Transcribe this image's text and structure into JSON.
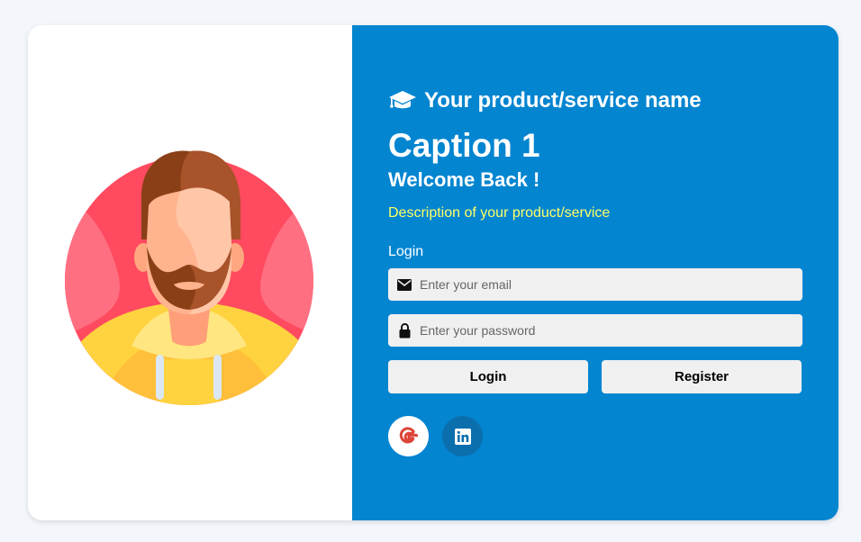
{
  "brand": {
    "icon": "graduation-cap-icon",
    "name": "Your product/service name"
  },
  "caption": "Caption 1",
  "welcome": "Welcome Back !",
  "description": "Description of your product/service",
  "form": {
    "section_label": "Login",
    "email": {
      "icon": "envelope-icon",
      "placeholder": "Enter your email",
      "value": ""
    },
    "password": {
      "icon": "lock-icon",
      "placeholder": "Enter your password",
      "value": ""
    },
    "login_button": "Login",
    "register_button": "Register"
  },
  "social": [
    {
      "name": "google",
      "icon": "google-icon"
    },
    {
      "name": "linkedin",
      "icon": "linkedin-icon"
    }
  ],
  "colors": {
    "page_background": "#f3f6fa",
    "panel_accent": "#0385d0",
    "description_text": "#ffff66",
    "input_background": "#f0f0f0",
    "linkedin_button": "#0b6fae"
  }
}
